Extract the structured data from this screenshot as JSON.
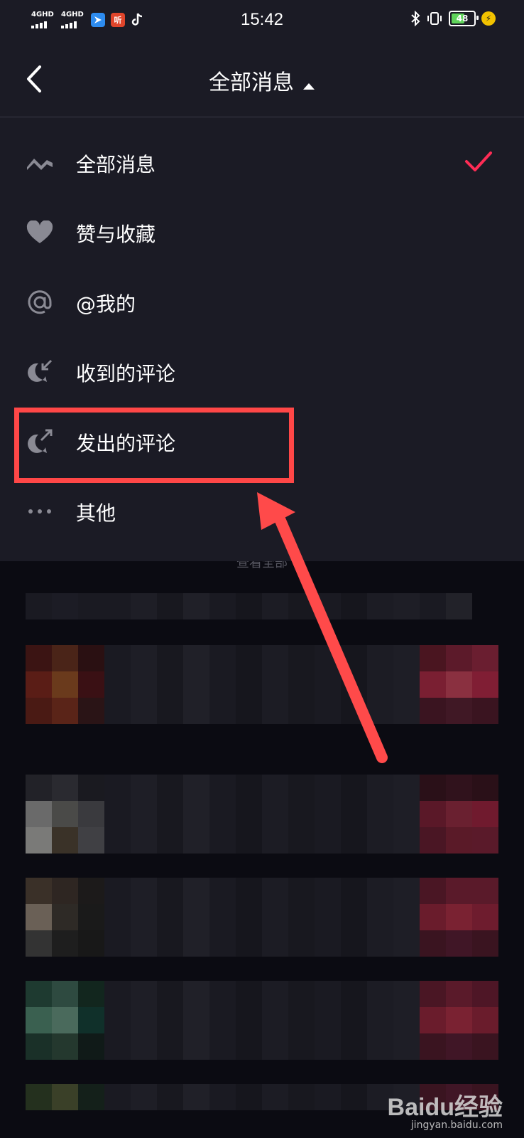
{
  "status_bar": {
    "network_1": "4GHD",
    "network_2": "4GHD",
    "app_icon_3": "听",
    "time": "15:42",
    "battery": "48"
  },
  "nav": {
    "title": "全部消息"
  },
  "menu": {
    "items": [
      {
        "label": "全部消息",
        "icon": "wave-icon",
        "selected": true
      },
      {
        "label": "赞与收藏",
        "icon": "heart-icon",
        "selected": false
      },
      {
        "label": "@我的",
        "icon": "at-icon",
        "selected": false
      },
      {
        "label": "收到的评论",
        "icon": "comment-received-icon",
        "selected": false
      },
      {
        "label": "发出的评论",
        "icon": "comment-sent-icon",
        "selected": false
      },
      {
        "label": "其他",
        "icon": "more-dots-icon",
        "selected": false
      }
    ]
  },
  "feed": {
    "peek_text": "查看全部"
  },
  "watermark": {
    "logo": "Baidu经验",
    "url": "jingyan.baidu.com"
  },
  "colors": {
    "background": "#0b0b12",
    "panel": "#1b1b25",
    "accent_check": "#fe2c55",
    "annotation_red": "#ff4747",
    "battery_green": "#5fd35a"
  }
}
